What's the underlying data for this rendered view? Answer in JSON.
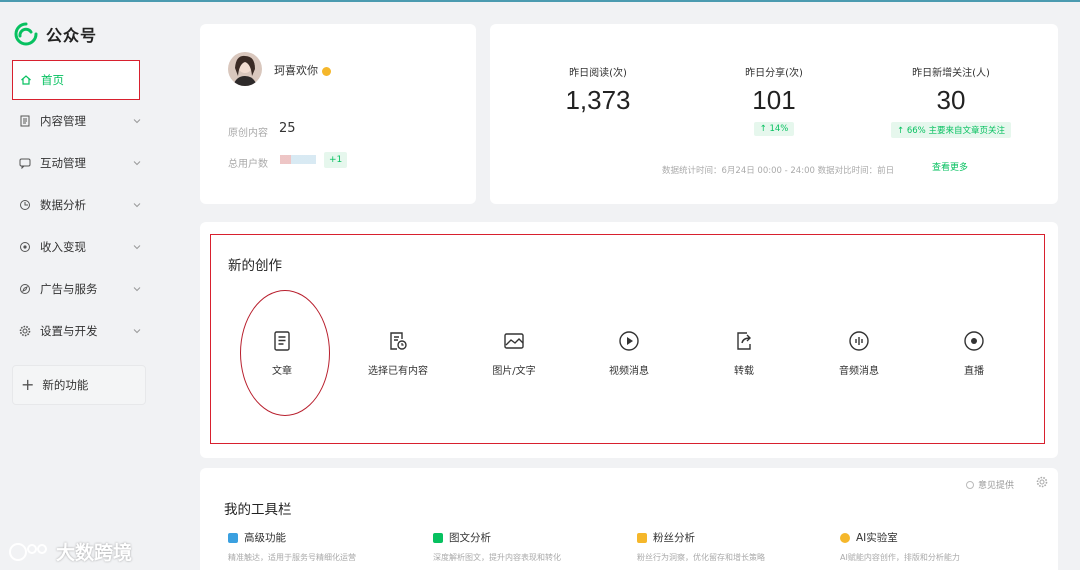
{
  "app": {
    "name": "公众号"
  },
  "sidebar": {
    "items": [
      {
        "label": "首页",
        "icon": "home-icon"
      },
      {
        "label": "内容管理",
        "icon": "document-icon"
      },
      {
        "label": "互动管理",
        "icon": "chat-icon"
      },
      {
        "label": "数据分析",
        "icon": "clock-chart-icon"
      },
      {
        "label": "收入变现",
        "icon": "target-icon"
      },
      {
        "label": "广告与服务",
        "icon": "compass-icon"
      },
      {
        "label": "设置与开发",
        "icon": "gear-icon"
      }
    ],
    "new_feature": "新的功能"
  },
  "profile": {
    "name": "珂喜欢你",
    "original_label": "原创内容",
    "original_value": "25",
    "users_label": "总用户数",
    "users_badge": "+1"
  },
  "stats": {
    "reads": {
      "label": "昨日阅读(次)",
      "value": "1,373"
    },
    "shares": {
      "label": "昨日分享(次)",
      "value": "101",
      "badge": "↑ 14%"
    },
    "follows": {
      "label": "昨日新增关注(人)",
      "value": "30",
      "badge": "↑ 66%  主要来自文章页关注"
    },
    "note": "数据统计时间：6月24日 00:00 - 24:00  数据对比时间：前日",
    "see_more": "查看更多"
  },
  "create": {
    "title": "新的创作",
    "tools": [
      {
        "label": "文章",
        "icon": "article-icon"
      },
      {
        "label": "选择已有内容",
        "icon": "select-content-icon"
      },
      {
        "label": "图片/文字",
        "icon": "image-text-icon"
      },
      {
        "label": "视频消息",
        "icon": "video-play-icon"
      },
      {
        "label": "转载",
        "icon": "repost-icon"
      },
      {
        "label": "音频消息",
        "icon": "audio-icon"
      },
      {
        "label": "直播",
        "icon": "live-icon"
      }
    ]
  },
  "toolbar": {
    "title": "我的工具栏",
    "feedback": "意见提供",
    "items": [
      {
        "title": "高级功能",
        "desc": "精准触达，适用于服务号精细化运营",
        "color": "#3aa0e0"
      },
      {
        "title": "图文分析",
        "desc": "深度解析图文，提升内容表现和转化",
        "color": "#07c160"
      },
      {
        "title": "粉丝分析",
        "desc": "粉丝行为洞察，优化留存和增长策略",
        "color": "#f5b72b"
      },
      {
        "title": "AI实验室",
        "desc": "AI赋能内容创作，排版和分析能力",
        "color": "#f5b72b"
      }
    ]
  },
  "watermark": {
    "text": "大数跨境"
  },
  "colors": {
    "accent": "#07c160",
    "highlight_red": "#d8202e"
  }
}
